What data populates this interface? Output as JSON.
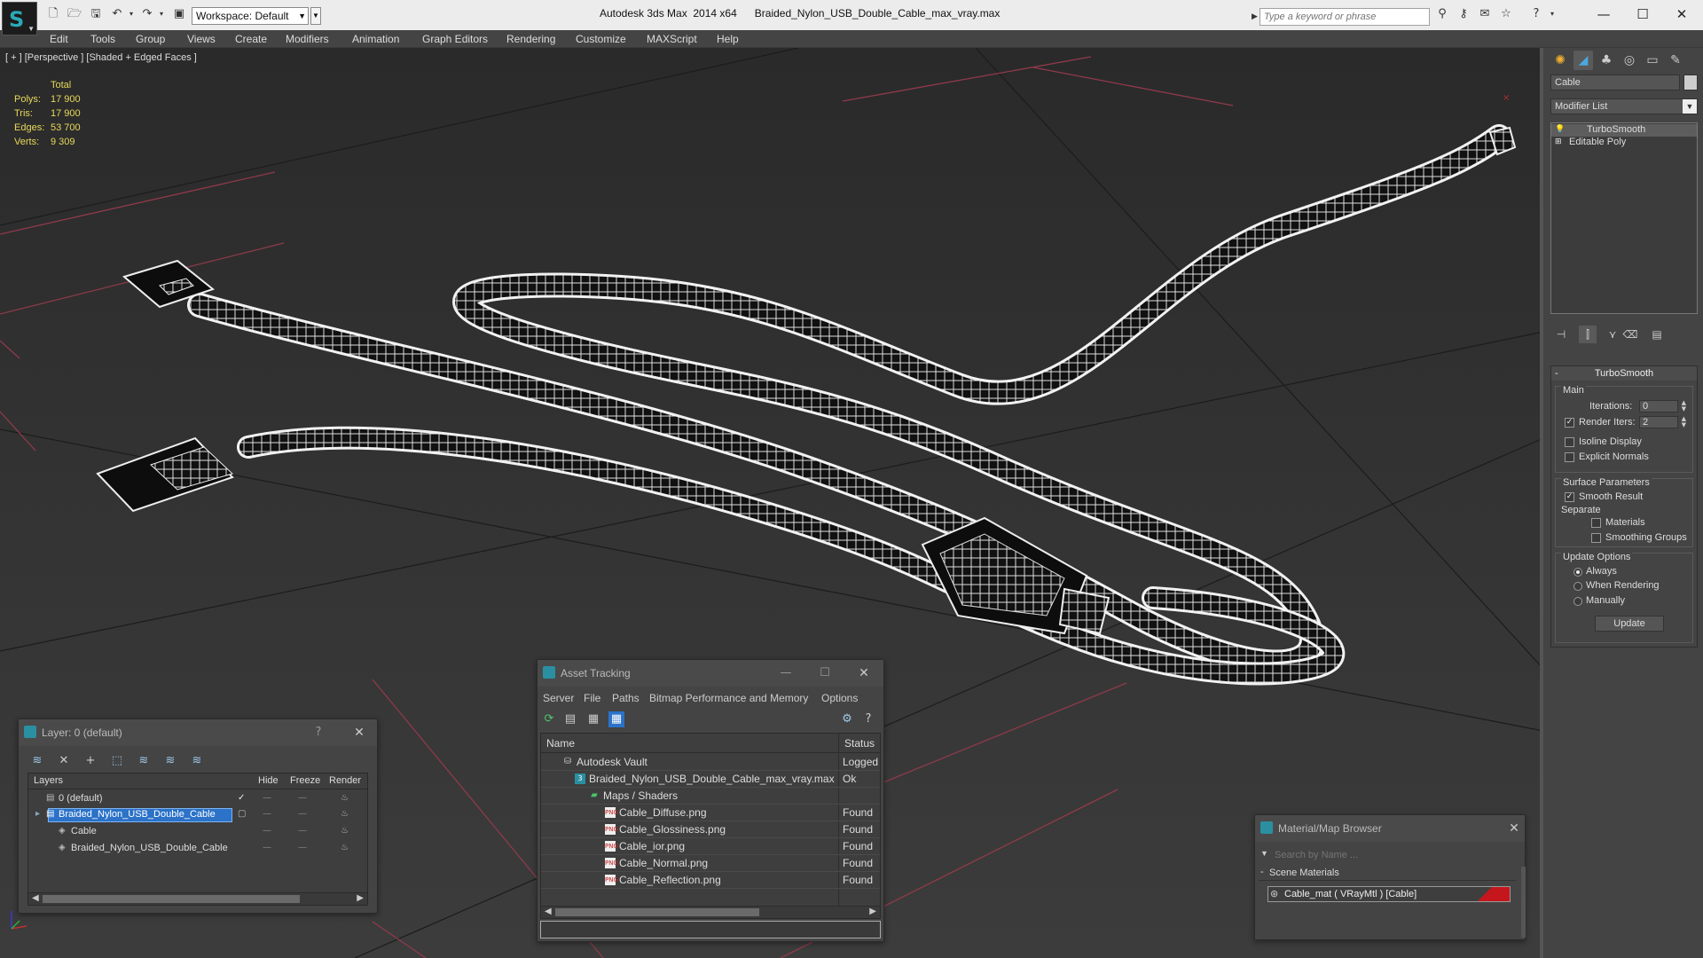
{
  "window": {
    "title": "Autodesk 3ds Max  2014 x64      Braided_Nylon_USB_Double_Cable_max_vray.max",
    "workspace": "Workspace: Default",
    "search_placeholder": "Type a keyword or phrase"
  },
  "menubar": {
    "items": [
      "Edit",
      "Tools",
      "Group",
      "Views",
      "Create",
      "Modifiers",
      "Animation",
      "Graph Editors",
      "Rendering",
      "Customize",
      "MAXScript",
      "Help"
    ]
  },
  "viewport": {
    "label": "[ + ] [Perspective ] [Shaded + Edged Faces ]",
    "stats": {
      "header": "Total",
      "rows": [
        {
          "label": "Polys:",
          "value": "17 900"
        },
        {
          "label": "Tris:",
          "value": "17 900"
        },
        {
          "label": "Edges:",
          "value": "53 700"
        },
        {
          "label": "Verts:",
          "value": "9 309"
        }
      ]
    }
  },
  "layer_panel": {
    "title": "Layer: 0 (default)",
    "help": "?",
    "columns": [
      "Layers",
      "Hide",
      "Freeze",
      "Render"
    ],
    "rows": [
      {
        "name": "0 (default)"
      },
      {
        "name": "Braided_Nylon_USB_Double_Cable"
      },
      {
        "name": "Cable"
      },
      {
        "name": "Braided_Nylon_USB_Double_Cable"
      }
    ]
  },
  "asset_panel": {
    "title": "Asset Tracking",
    "menu": [
      "Server",
      "File",
      "Paths",
      "Bitmap Performance and Memory",
      "Options"
    ],
    "columns": [
      "Name",
      "Status"
    ],
    "rows": [
      {
        "name": "Autodesk Vault",
        "status": "Logged"
      },
      {
        "name": "Braided_Nylon_USB_Double_Cable_max_vray.max",
        "status": "Ok"
      },
      {
        "name": "Maps / Shaders",
        "status": ""
      },
      {
        "name": "Cable_Diffuse.png",
        "status": "Found"
      },
      {
        "name": "Cable_Glossiness.png",
        "status": "Found"
      },
      {
        "name": "Cable_ior.png",
        "status": "Found"
      },
      {
        "name": "Cable_Normal.png",
        "status": "Found"
      },
      {
        "name": "Cable_Reflection.png",
        "status": "Found"
      }
    ]
  },
  "material_browser": {
    "title": "Material/Map Browser",
    "search_placeholder": "Search by Name ...",
    "section": "Scene Materials",
    "item": "Cable_mat  ( VRayMtl )  [Cable]"
  },
  "command_panel": {
    "object_name": "Cable",
    "modifier_list": "Modifier List",
    "stack": [
      "TurboSmooth",
      "Editable Poly"
    ],
    "rollout_title": "TurboSmooth",
    "main_label": "Main",
    "iterations_label": "Iterations:",
    "iterations_value": "0",
    "render_iters_label": "Render Iters:",
    "render_iters_value": "2",
    "render_iters_checked": true,
    "isoline_label": "Isoline Display",
    "explicit_normals_label": "Explicit Normals",
    "surface_params_label": "Surface Parameters",
    "smooth_result_label": "Smooth Result",
    "smooth_result_checked": true,
    "separate_label": "Separate",
    "materials_label": "Materials",
    "smoothing_groups_label": "Smoothing Groups",
    "update_options_label": "Update Options",
    "update_options": [
      "Always",
      "When Rendering",
      "Manually"
    ],
    "update_selected": "Always",
    "update_button": "Update"
  },
  "colors": {
    "accent": "#2b72c8",
    "stats_yellow": "#e8d95a",
    "swatch_red": "#c4161c"
  }
}
